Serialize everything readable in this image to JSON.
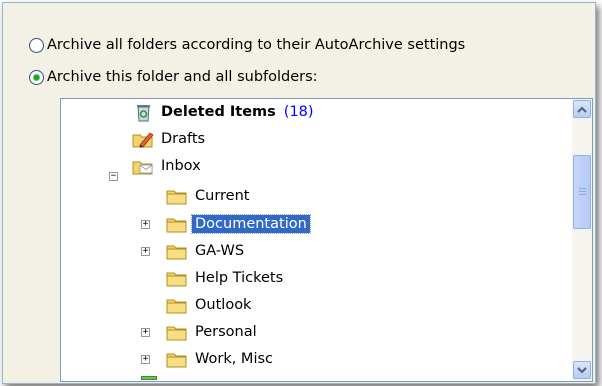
{
  "options": {
    "archive_all_label": "Archive all folders according to their AutoArchive settings",
    "archive_this_label": "Archive this folder and all subfolders:",
    "selected": "archive_this"
  },
  "tree": {
    "nodes": [
      {
        "label": "Deleted Items",
        "count": "(18)",
        "icon": "trash-can-icon",
        "bold": true
      },
      {
        "label": "Drafts",
        "icon": "drafts-icon"
      },
      {
        "label": "Inbox",
        "icon": "inbox-icon",
        "expander": "collapse"
      },
      {
        "label": "Current",
        "icon": "folder-icon"
      },
      {
        "label": "Documentation",
        "icon": "folder-icon",
        "expander": "expand",
        "selected": true
      },
      {
        "label": "GA-WS",
        "icon": "folder-icon",
        "expander": "expand"
      },
      {
        "label": "Help Tickets",
        "icon": "folder-icon"
      },
      {
        "label": "Outlook",
        "icon": "folder-icon"
      },
      {
        "label": "Personal",
        "icon": "folder-icon",
        "expander": "expand"
      },
      {
        "label": "Work, Misc",
        "icon": "folder-icon",
        "expander": "expand"
      }
    ]
  },
  "colors": {
    "selection": "#316ac5",
    "count": "#0000ff",
    "radio_dot": "#21a121",
    "dialog_bg": "#f3f1e6"
  }
}
